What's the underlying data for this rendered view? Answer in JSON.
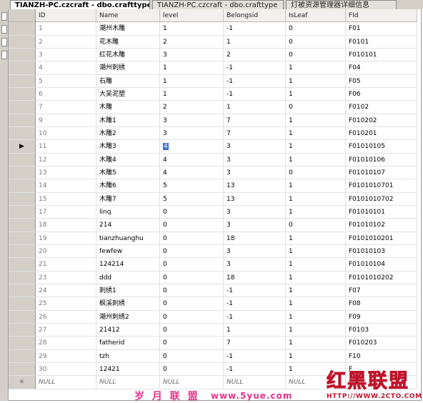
{
  "tabs": [
    {
      "label": "TIANZH-PC.czcraft - dbo.crafttype",
      "active": true
    },
    {
      "label": "TIANZH-PC.czcraft - dbo.crafttype",
      "active": false
    },
    {
      "label": "灯被资源管理器详细信息",
      "active": false
    }
  ],
  "columns": [
    "ID",
    "Name",
    "level",
    "Belongsid",
    "IsLeaf",
    "FId"
  ],
  "rows": [
    [
      "1",
      "潮州木雕",
      "1",
      "-1",
      "0",
      "F01"
    ],
    [
      "2",
      "花木雕",
      "2",
      "1",
      "0",
      "F0101"
    ],
    [
      "3",
      "红花木雕",
      "3",
      "2",
      "0",
      "F010101"
    ],
    [
      "4",
      "潮州刺绣",
      "1",
      "-1",
      "1",
      "F04"
    ],
    [
      "5",
      "石雕",
      "1",
      "-1",
      "1",
      "F05"
    ],
    [
      "6",
      "大吴泥塑",
      "1",
      "-1",
      "1",
      "F06"
    ],
    [
      "7",
      "木雕",
      "2",
      "1",
      "0",
      "F0102"
    ],
    [
      "9",
      "木雕1",
      "3",
      "7",
      "1",
      "F010202"
    ],
    [
      "10",
      "木雕2",
      "3",
      "7",
      "1",
      "F010201"
    ],
    [
      "11",
      "木雕3",
      "4",
      "3",
      "1",
      "F01010105"
    ],
    [
      "12",
      "木雕4",
      "4",
      "3",
      "1",
      "F01010106"
    ],
    [
      "13",
      "木雕5",
      "4",
      "3",
      "0",
      "F01010107"
    ],
    [
      "14",
      "木雕6",
      "5",
      "13",
      "1",
      "F0101010701"
    ],
    [
      "15",
      "木雕7",
      "5",
      "13",
      "1",
      "F0101010702"
    ],
    [
      "17",
      "linq",
      "0",
      "3",
      "1",
      "F01010101"
    ],
    [
      "18",
      "214",
      "0",
      "3",
      "0",
      "F01010102"
    ],
    [
      "19",
      "tianzhuanghu",
      "0",
      "18",
      "1",
      "F0101010201"
    ],
    [
      "20",
      "fewfew",
      "0",
      "3",
      "1",
      "F01010103"
    ],
    [
      "21",
      "124214",
      "0",
      "3",
      "1",
      "F01010104"
    ],
    [
      "23",
      "ddd",
      "0",
      "18",
      "1",
      "F0101010202"
    ],
    [
      "24",
      "刺绣1",
      "0",
      "-1",
      "1",
      "F07"
    ],
    [
      "25",
      "枫溪刺绣",
      "0",
      "-1",
      "1",
      "F08"
    ],
    [
      "26",
      "潮州刺绣2",
      "0",
      "-1",
      "1",
      "F09"
    ],
    [
      "27",
      "21412",
      "0",
      "1",
      "1",
      "F0103"
    ],
    [
      "28",
      "fatherid",
      "0",
      "7",
      "1",
      "F010203"
    ],
    [
      "29",
      "tzh",
      "0",
      "-1",
      "1",
      "F10"
    ],
    [
      "30",
      "12421",
      "0",
      "-1",
      "1",
      "F"
    ]
  ],
  "new_row": [
    "NULL",
    "NULL",
    "NULL",
    "NULL",
    "NULL",
    "NULL"
  ],
  "selected_row_index": 9,
  "current_row_marker": "▶",
  "new_row_marker": "✳",
  "watermark": {
    "text1": "岁 月 联 盟",
    "text2": "www.5yue.com",
    "logo_text": "红黑联盟",
    "url": "HTTP://WWW.2CTO.COM"
  },
  "colors": {
    "header_bg": "#f1f0ec",
    "selector_bg": "#d4d0c8",
    "watermark_pink": "#e8348a",
    "logo_red": "#c0152c"
  }
}
